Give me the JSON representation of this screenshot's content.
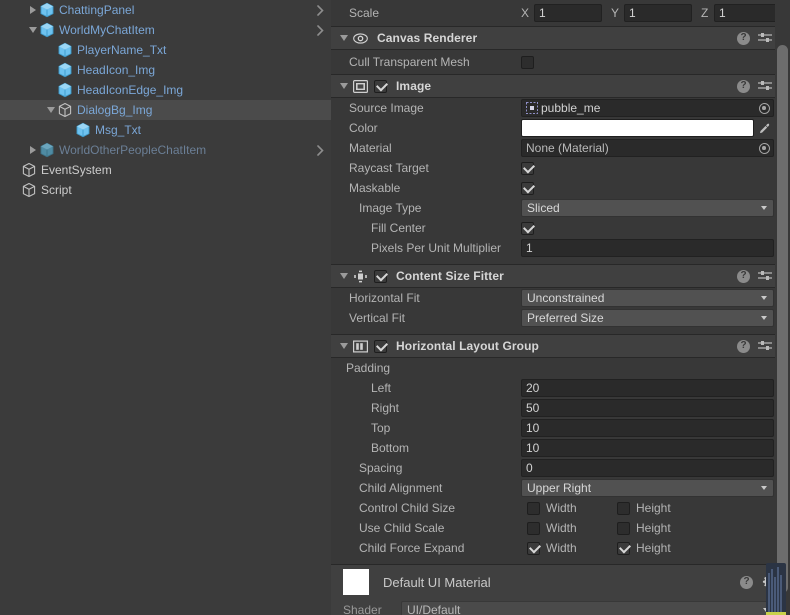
{
  "hierarchy": {
    "items": [
      {
        "label": "ChattingPanel",
        "indent": 1,
        "fold": "right",
        "icon": "prefab-cube-icon",
        "state": "prefab",
        "chevron": true,
        "selected": false
      },
      {
        "label": "WorldMyChatItem",
        "indent": 1,
        "fold": "down",
        "icon": "prefab-cube-icon",
        "state": "prefab",
        "chevron": true,
        "selected": false
      },
      {
        "label": "PlayerName_Txt",
        "indent": 2,
        "fold": "none",
        "icon": "gameobject-cube-icon",
        "state": "prefab",
        "chevron": false,
        "selected": false
      },
      {
        "label": "HeadIcon_Img",
        "indent": 2,
        "fold": "none",
        "icon": "gameobject-cube-icon",
        "state": "prefab",
        "chevron": false,
        "selected": false
      },
      {
        "label": "HeadIconEdge_Img",
        "indent": 2,
        "fold": "none",
        "icon": "gameobject-cube-icon",
        "state": "prefab",
        "chevron": false,
        "selected": false
      },
      {
        "label": "DialogBg_Img",
        "indent": 2,
        "fold": "down",
        "icon": "gameobject-cube-icon",
        "state": "selected",
        "chevron": false,
        "selected": true
      },
      {
        "label": "Msg_Txt",
        "indent": 3,
        "fold": "none",
        "icon": "gameobject-cube-icon",
        "state": "prefab",
        "chevron": false,
        "selected": false
      },
      {
        "label": "WorldOtherPeopleChatItem",
        "indent": 1,
        "fold": "right",
        "icon": "prefab-cube-icon",
        "state": "inactive",
        "chevron": true,
        "selected": false
      },
      {
        "label": "EventSystem",
        "indent": 0,
        "fold": "none",
        "icon": "gameobject-cube-icon",
        "state": "plain",
        "chevron": false,
        "selected": false
      },
      {
        "label": "Script",
        "indent": 0,
        "fold": "none",
        "icon": "gameobject-cube-icon",
        "state": "plain",
        "chevron": false,
        "selected": false
      }
    ]
  },
  "inspector": {
    "transform_tail": {
      "scale_label": "Scale",
      "x_axis": "X",
      "y_axis": "Y",
      "z_axis": "Z",
      "x": "1",
      "y": "1",
      "z": "1"
    },
    "canvas_renderer": {
      "title": "Canvas Renderer",
      "icon": "eye-icon",
      "cull_label": "Cull Transparent Mesh",
      "cull_checked": false
    },
    "image": {
      "title": "Image",
      "icon": "image-component-icon",
      "enabled": true,
      "source_image_label": "Source Image",
      "source_image_value": "pubble_me",
      "color_label": "Color",
      "color_value": "#FFFFFF",
      "material_label": "Material",
      "material_value": "None (Material)",
      "raycast_label": "Raycast Target",
      "raycast_checked": true,
      "maskable_label": "Maskable",
      "maskable_checked": true,
      "image_type_label": "Image Type",
      "image_type_value": "Sliced",
      "fill_center_label": "Fill Center",
      "fill_center_checked": true,
      "ppu_label": "Pixels Per Unit Multiplier",
      "ppu_value": "1"
    },
    "content_size_fitter": {
      "title": "Content Size Fitter",
      "icon": "content-size-fitter-icon",
      "enabled": true,
      "horizontal_fit_label": "Horizontal Fit",
      "horizontal_fit_value": "Unconstrained",
      "vertical_fit_label": "Vertical Fit",
      "vertical_fit_value": "Preferred Size"
    },
    "horizontal_layout_group": {
      "title": "Horizontal Layout Group",
      "icon": "horizontal-layout-group-icon",
      "enabled": true,
      "padding_label": "Padding",
      "left_label": "Left",
      "left_value": "20",
      "right_label": "Right",
      "right_value": "50",
      "top_label": "Top",
      "top_value": "10",
      "bottom_label": "Bottom",
      "bottom_value": "10",
      "spacing_label": "Spacing",
      "spacing_value": "0",
      "child_alignment_label": "Child Alignment",
      "child_alignment_value": "Upper Right",
      "control_child_size_label": "Control Child Size",
      "control_child_size_width": false,
      "control_child_size_height": false,
      "use_child_scale_label": "Use Child Scale",
      "use_child_scale_width": false,
      "use_child_scale_height": false,
      "child_force_expand_label": "Child Force Expand",
      "child_force_expand_width": true,
      "child_force_expand_height": true,
      "width_label": "Width",
      "height_label": "Height"
    },
    "material_preview": {
      "name": "Default UI Material",
      "shader_label": "Shader",
      "shader_value": "UI/Default"
    }
  }
}
